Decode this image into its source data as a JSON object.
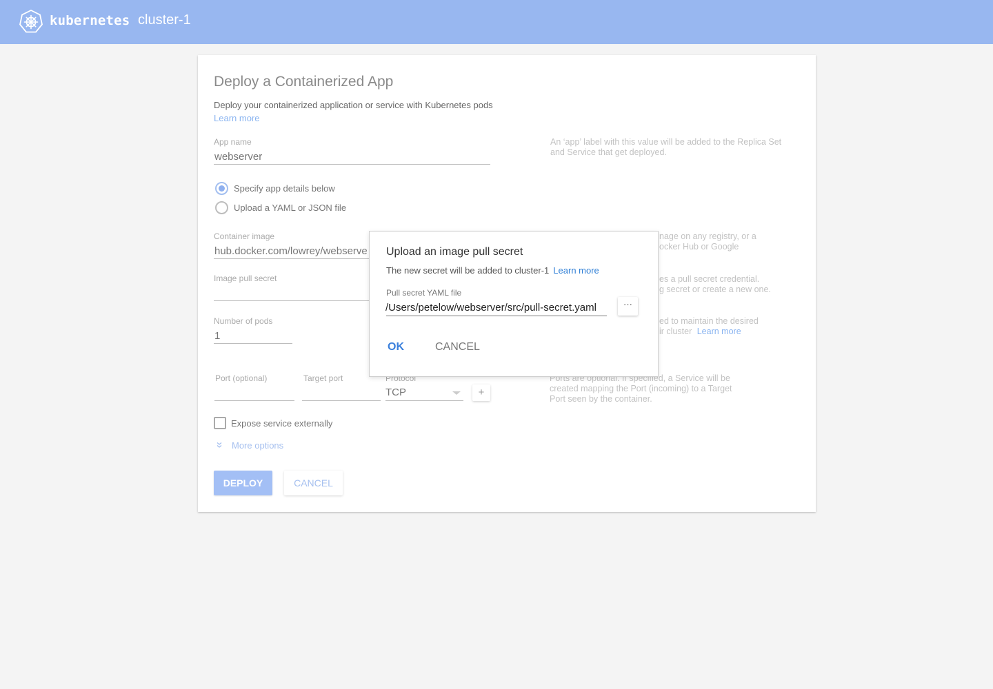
{
  "header": {
    "logo_icon": "kubernetes-helm-icon",
    "brand": "kubernetes",
    "cluster": "cluster-1",
    "color": "#98b7f0"
  },
  "form": {
    "title": "Deploy a Containerized App",
    "subtitle": "Deploy your containerized application or service with Kubernetes pods",
    "learn_more": "Learn more",
    "app_name": {
      "label": "App name",
      "value": "webserver",
      "help": "An ‘app’ label with this value will be added to the Replica Set and Service that get deployed."
    },
    "mode_options": [
      {
        "label": "Specify app details below",
        "selected": true
      },
      {
        "label": "Upload a YAML or JSON file",
        "selected": false
      }
    ],
    "container_image": {
      "label": "Container image",
      "value": "hub.docker.com/lowrey/webserve",
      "help_line1": "nage on any registry, or a",
      "help_line2": "ocker Hub or Google"
    },
    "image_pull_secret": {
      "label": "Image pull secret",
      "value": "",
      "help_line1": "es a pull secret credential.",
      "help_line2": "g secret or create a new one."
    },
    "number_of_pods": {
      "label": "Number of pods",
      "value": "1",
      "help_line1": "ed to maintain the desired",
      "help_line2": "ir cluster",
      "help_link": "Learn more"
    },
    "ports": {
      "port_label": "Port (optional)",
      "port_value": "",
      "target_label": "Target port",
      "target_value": "",
      "protocol_label": "Protocol",
      "protocol_value": "TCP",
      "add_label": "+",
      "help": "Ports are optional.  If specified, a Service will be created mapping the Port (incoming) to a Target Port seen by the container."
    },
    "expose_externally": {
      "label": "Expose service externally",
      "checked": false
    },
    "more_options": "More options",
    "deploy_label": "DEPLOY",
    "cancel_label": "CANCEL"
  },
  "dialog": {
    "title": "Upload an image pull secret",
    "subtitle": "The new secret will be added to cluster-1",
    "learn_more": "Learn more",
    "field_label": "Pull secret YAML file",
    "field_value": "/Users/petelow/webserver/src/pull-secret.yaml",
    "browse_label": "···",
    "ok_label": "OK",
    "cancel_label": "CANCEL"
  }
}
